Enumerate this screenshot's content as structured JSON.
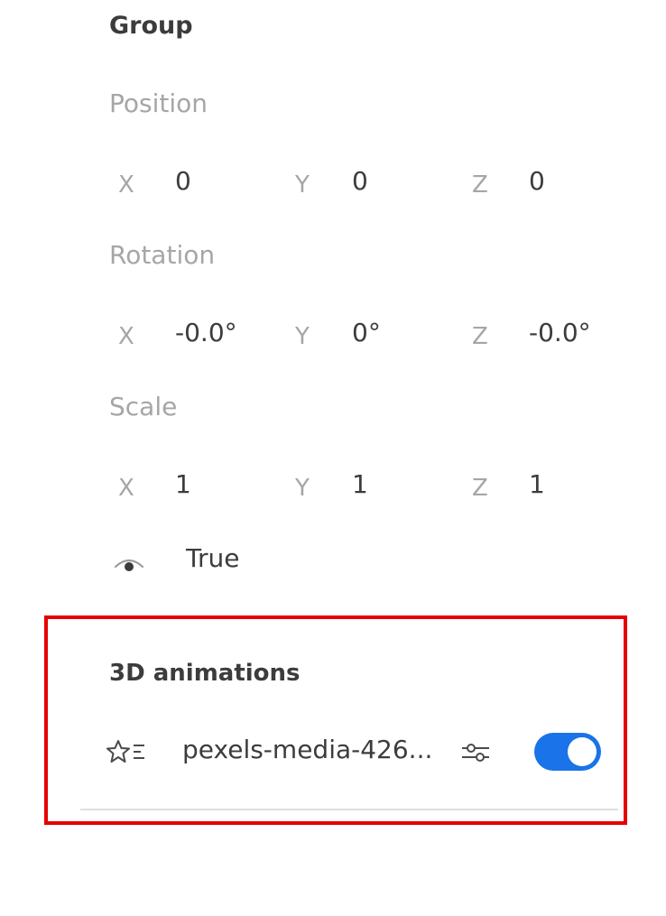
{
  "group": {
    "title": "Group"
  },
  "position": {
    "label": "Position",
    "x_label": "X",
    "x": "0",
    "y_label": "Y",
    "y": "0",
    "z_label": "Z",
    "z": "0"
  },
  "rotation": {
    "label": "Rotation",
    "x_label": "X",
    "x": "-0.0°",
    "y_label": "Y",
    "y": "0°",
    "z_label": "Z",
    "z": "-0.0°"
  },
  "scale": {
    "label": "Scale",
    "x_label": "X",
    "x": "1",
    "y_label": "Y",
    "y": "1",
    "z_label": "Z",
    "z": "1"
  },
  "visibility": {
    "icon": "eye-icon",
    "value": "True"
  },
  "animations": {
    "title": "3D animations",
    "items": [
      {
        "icon": "star-list-icon",
        "name": "pexels-media-426...",
        "settings_icon": "sliders-icon",
        "enabled": true
      }
    ]
  },
  "colors": {
    "toggle_on": "#1a73e8",
    "highlight_border": "#e60000",
    "label_gray": "#a6a6a6",
    "text_dark": "#3c3c3c"
  }
}
